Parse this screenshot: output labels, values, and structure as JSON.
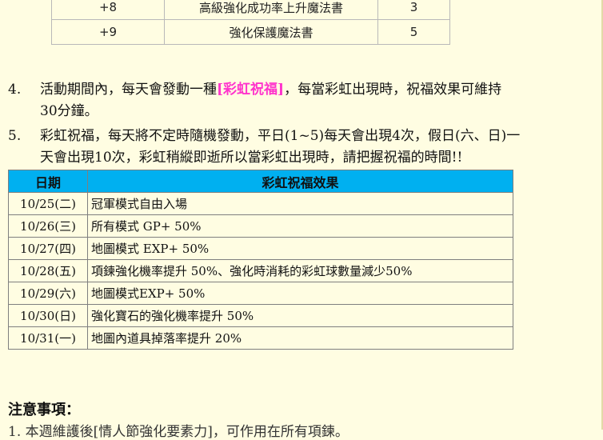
{
  "top_table": {
    "rows": [
      [
        "+8",
        "高級強化成功率上升魔法書",
        "3"
      ],
      [
        "+9",
        "強化保護魔法書",
        "5"
      ]
    ]
  },
  "items": {
    "item4": {
      "number": "4.",
      "text_before": "活動期間內，每天會發動一種",
      "highlight": "[彩虹祝福]",
      "text_after": "，每當彩虹出現時，祝福效果可維持",
      "line2": "30分鐘。"
    },
    "item5": {
      "number": "5.",
      "line1": "彩虹祝福，每天將不定時隨機發動，平日(1~5)每天會出現4次，假日(六、日)一",
      "line2": "天會出現10次，彩虹稍縱即逝所以當彩虹出現時，請把握祝福的時間!!"
    }
  },
  "schedule_table": {
    "headers": [
      "日期",
      "彩虹祝福效果"
    ],
    "rows": [
      [
        "10/25(二)",
        "冠軍模式自由入場"
      ],
      [
        "10/26(三)",
        "所有模式 GP+ 50%"
      ],
      [
        "10/27(四)",
        "地圖模式 EXP+ 50%"
      ],
      [
        "10/28(五)",
        "項鍊強化機率提升 50%、強化時消耗的彩虹球數量減少50%"
      ],
      [
        "10/29(六)",
        "地圖模式EXP+ 50%"
      ],
      [
        "10/30(日)",
        "強化寶石的強化機率提升 50%"
      ],
      [
        "10/31(一)",
        "地圖內道具掉落率提升 20%"
      ]
    ],
    "header_color": "#00b0f0"
  },
  "notes": {
    "title": "注意事項：",
    "cut_line": "1.      本週維護後[情人節強化要素力]，可作用在所有項鍊。"
  },
  "colors": {
    "background": "#fffde2",
    "highlight": "#ff33cc"
  }
}
